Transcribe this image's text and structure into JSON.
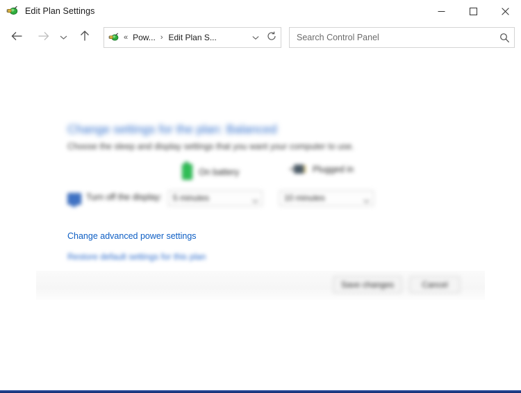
{
  "window": {
    "title": "Edit Plan Settings",
    "app_icon": "power-plan-icon",
    "controls": {
      "minimize": "minimize-icon",
      "maximize": "maximize-icon",
      "close": "close-icon"
    }
  },
  "navbar": {
    "back": "back-arrow-icon",
    "forward": "forward-arrow-icon",
    "recent": "recent-locations-chevron-icon",
    "up": "up-arrow-icon",
    "address": {
      "icon": "power-plan-icon",
      "overflow": "«",
      "crumb_1": "Pow...",
      "separator": "›",
      "crumb_2": "Edit Plan S...",
      "dropdown": "chevron-down-icon",
      "refresh": "refresh-icon"
    },
    "search": {
      "placeholder": "Search Control Panel",
      "value": "",
      "icon": "search-icon"
    }
  },
  "content": {
    "heading": "Change settings for the plan: Balanced",
    "subtitle": "Choose the sleep and display settings that you want your computer to use.",
    "columns": [
      {
        "label": "On battery",
        "icon": "battery-icon"
      },
      {
        "label": "Plugged in",
        "icon": "power-plug-icon"
      }
    ],
    "rows": [
      {
        "icon": "display-monitor-icon",
        "label": "Turn off the display:",
        "on_battery_value": "5 minutes",
        "plugged_in_value": "10 minutes",
        "chevron": "chevron-down-icon"
      }
    ],
    "links": {
      "advanced": "Change advanced power settings",
      "restore": "Restore default settings for this plan"
    },
    "buttons": {
      "save": "Save changes",
      "cancel": "Cancel"
    }
  },
  "colors": {
    "link_blue": "#0d5ec4",
    "heading_blue": "#2c6ccc",
    "battery_green": "#2fbd55",
    "taskbar_blue": "#1b3a86"
  }
}
